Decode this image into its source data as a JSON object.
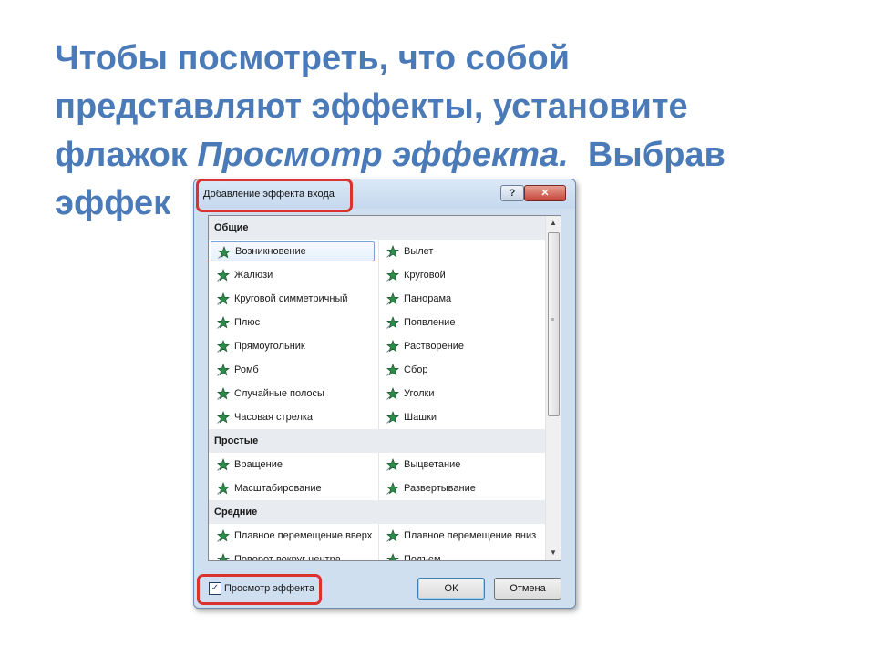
{
  "slide": {
    "line1": "Чтобы посмотреть, что собой",
    "line2": "представляют эффекты, установите",
    "line3_a": "флажок ",
    "line3_italic": "Просмотр эффекта.",
    "line3_b": "  Выбрав",
    "line4": "эффек"
  },
  "dialog": {
    "title": "Добавление эффекта входа",
    "help_label": "?",
    "close_label": "✕",
    "groups": [
      {
        "header": "Общие",
        "items": [
          [
            "Возникновение",
            "Вылет"
          ],
          [
            "Жалюзи",
            "Круговой"
          ],
          [
            "Круговой симметричный",
            "Панорама"
          ],
          [
            "Плюс",
            "Появление"
          ],
          [
            "Прямоугольник",
            "Растворение"
          ],
          [
            "Ромб",
            "Сбор"
          ],
          [
            "Случайные полосы",
            "Уголки"
          ],
          [
            "Часовая стрелка",
            "Шашки"
          ]
        ]
      },
      {
        "header": "Простые",
        "items": [
          [
            "Вращение",
            "Выцветание"
          ],
          [
            "Масштабирование",
            "Развертывание"
          ]
        ]
      },
      {
        "header": "Средние",
        "items": [
          [
            "Плавное перемещение вверх",
            "Плавное перемещение вниз"
          ],
          [
            "Поворот вокруг центра",
            "Подъем"
          ]
        ]
      }
    ],
    "selected_item": "Возникновение",
    "preview_checkbox": {
      "label": "Просмотр эффекта",
      "checked": true
    },
    "ok_label": "ОК",
    "cancel_label": "Отмена",
    "icons": {
      "effect": "green-star-effect-icon"
    },
    "colors": {
      "accent_text": "#4a7ab7",
      "highlight": "#d9322f",
      "star": "#2d8c4a"
    }
  }
}
